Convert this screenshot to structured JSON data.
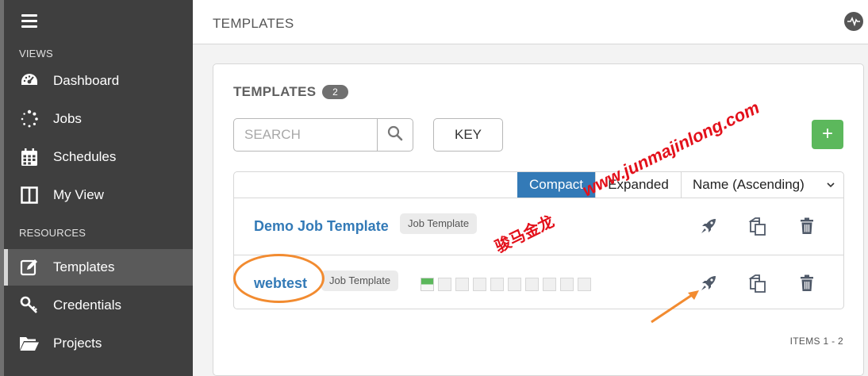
{
  "sidebar": {
    "sections": [
      {
        "label": "VIEWS"
      },
      {
        "label": "RESOURCES"
      }
    ],
    "items": [
      {
        "label": "Dashboard",
        "icon": "dashboard-icon"
      },
      {
        "label": "Jobs",
        "icon": "jobs-spinner-icon"
      },
      {
        "label": "Schedules",
        "icon": "calendar-icon"
      },
      {
        "label": "My View",
        "icon": "columns-icon"
      },
      {
        "label": "Templates",
        "icon": "edit-icon",
        "active": true
      },
      {
        "label": "Credentials",
        "icon": "key-icon"
      },
      {
        "label": "Projects",
        "icon": "folder-icon"
      }
    ]
  },
  "header": {
    "title": "TEMPLATES",
    "activity_icon": "activity-stream-icon"
  },
  "panel": {
    "title": "TEMPLATES",
    "count": "2",
    "search_placeholder": "SEARCH",
    "key_label": "KEY",
    "add_label": "+"
  },
  "list": {
    "view_compact": "Compact",
    "view_expanded": "Expanded",
    "sort_label": "Name (Ascending)",
    "rows": [
      {
        "name": "Demo Job Template",
        "type": "Job Template",
        "recent_jobs": []
      },
      {
        "name": "webtest",
        "type": "Job Template",
        "recent_jobs": [
          "successful",
          "none",
          "none",
          "none",
          "none",
          "none",
          "none",
          "none",
          "none",
          "none"
        ]
      }
    ],
    "items_label": "ITEMS  1 - 2"
  },
  "colors": {
    "sidebar": "#3f3f3f",
    "link": "#337ab7",
    "add_button": "#5cb85c",
    "compact_active": "#337ab7",
    "annotation": "#f28b30",
    "watermark": "#e3101a"
  },
  "annotations": {
    "watermark_url": "www.junmajinlong.com",
    "watermark_cn": "骏马金龙"
  }
}
